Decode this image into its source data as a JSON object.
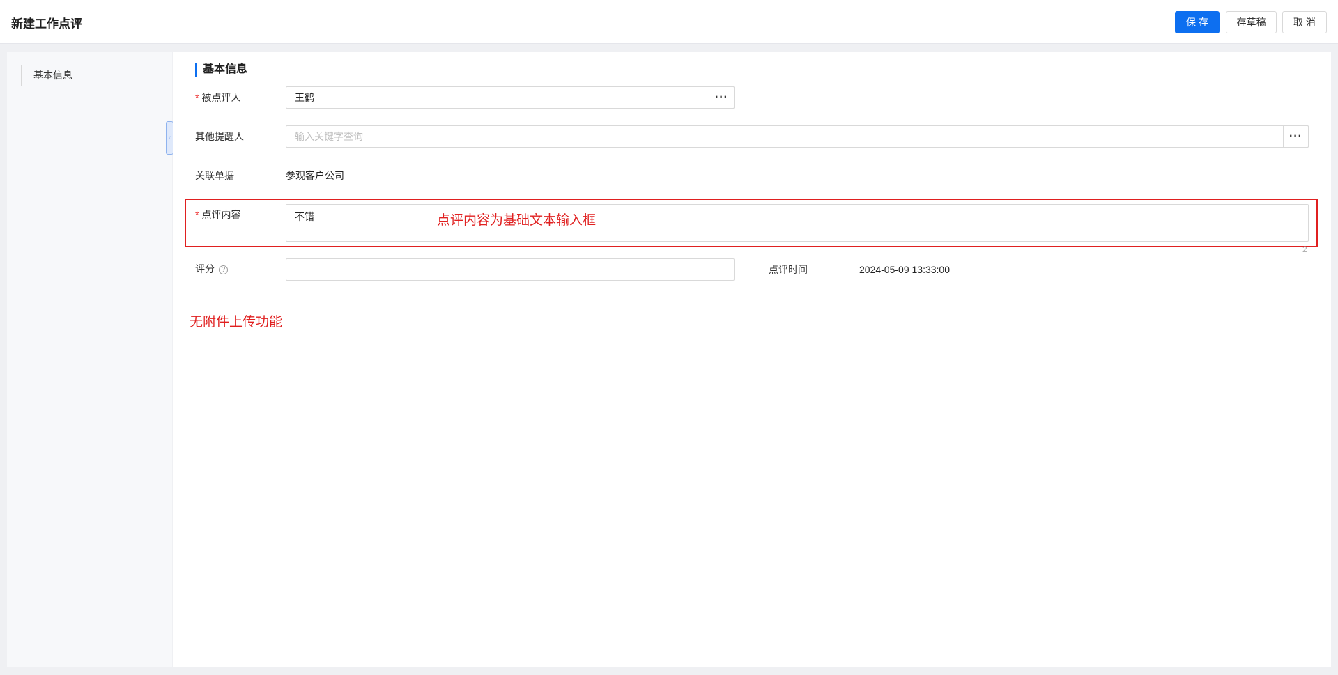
{
  "header": {
    "title": "新建工作点评",
    "save_label": "保 存",
    "draft_label": "存草稿",
    "cancel_label": "取 消"
  },
  "sidebar": {
    "items": [
      {
        "label": "基本信息"
      }
    ]
  },
  "section": {
    "title": "基本信息"
  },
  "form": {
    "reviewee": {
      "label": "被点评人",
      "value": "王鹤",
      "required": true
    },
    "others": {
      "label": "其他提醒人",
      "placeholder": "输入关键字查询"
    },
    "related": {
      "label": "关联单据",
      "value": "参观客户公司"
    },
    "content": {
      "label": "点评内容",
      "value": "不错",
      "required": true,
      "counter": "2"
    },
    "score": {
      "label": "评分",
      "value": ""
    },
    "review_time": {
      "label": "点评时间",
      "value": "2024-05-09 13:33:00"
    }
  },
  "annotations": {
    "content_note": "点评内容为基础文本输入框",
    "attachment_note": "无附件上传功能"
  },
  "icons": {
    "dots": "more-dots-icon",
    "help": "question-circle-icon",
    "collapse": "chevron-left-icon"
  },
  "colors": {
    "primary": "#0d6ff0",
    "required": "#e33333",
    "annotation": "#e02020"
  }
}
